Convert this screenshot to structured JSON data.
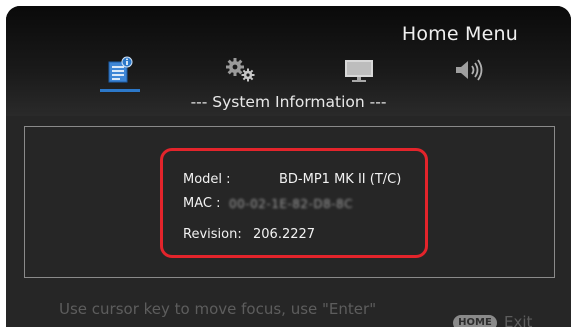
{
  "header": {
    "menu_title": "Home Menu",
    "tabs": [
      {
        "icon": "system-info-icon",
        "active": true
      },
      {
        "icon": "settings-gears-icon",
        "active": false
      },
      {
        "icon": "monitor-icon",
        "active": false
      },
      {
        "icon": "speaker-icon",
        "active": false
      }
    ],
    "section_title": "--- System Information ---"
  },
  "info": {
    "model_label": "Model :",
    "model_value": "BD-MP1 MK II (T/C)",
    "mac_label": "MAC :",
    "mac_value": "00-02-1E-82-D8-8C",
    "revision_label": "Revision:",
    "revision_value": "206.2227"
  },
  "footer": {
    "hint": "Use cursor key to move focus, use \"Enter\"",
    "home_key": "HOME",
    "exit_label": "Exit"
  },
  "colors": {
    "accent": "#2c78c9",
    "highlight_box": "#e3242b",
    "background": "#101010"
  }
}
